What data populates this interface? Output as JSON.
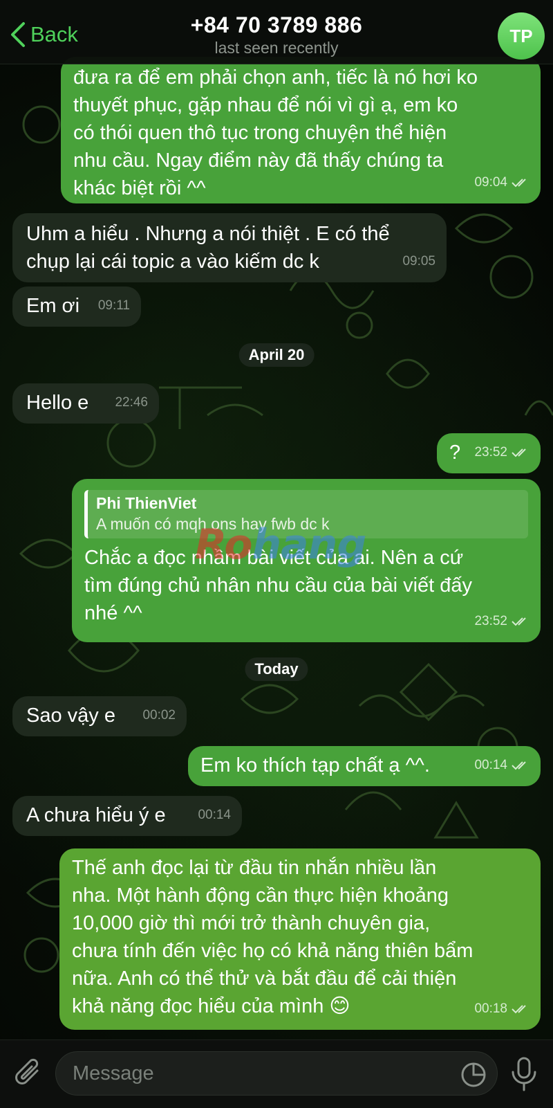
{
  "header": {
    "back_label": "Back",
    "title": "+84 70 3789 886",
    "status": "last seen recently",
    "avatar_initials": "TP"
  },
  "messages": [
    {
      "dir": "out",
      "text": "đưa ra để em phải chọn anh, tiếc là nó hơi ko\nthuyết phục, gặp nhau để nói vì gì ạ, em ko\ncó thói quen thô tục trong chuyện thể hiện\nnhu cầu. Ngay điểm này đã thấy chúng ta\nkhác biệt rồi ^^",
      "time": "09:04"
    },
    {
      "dir": "in",
      "text": "Uhm a hiểu . Nhưng a nói thiệt . E có thể\nchụp lại cái topic a vào kiếm dc k",
      "time": "09:05"
    },
    {
      "dir": "in",
      "text": "Em ơi",
      "time": "09:11"
    },
    {
      "dir": "in",
      "text": "Hello e",
      "time": "22:46"
    },
    {
      "dir": "out",
      "text": "?",
      "time": "23:52"
    },
    {
      "dir": "out",
      "reply_name": "Phi ThienViet",
      "reply_text": "A muốn có mqh ons hay fwb dc k",
      "text": "Chắc a đọc nhầm bài viết của ai. Nên a cứ\ntìm đúng chủ nhân nhu cầu của bài viết đấy\nnhé ^^",
      "time": "23:52"
    },
    {
      "dir": "in",
      "text": "Sao vậy e",
      "time": "00:02"
    },
    {
      "dir": "out",
      "text": "Em ko thích tạp chất ạ ^^.",
      "time": "00:14"
    },
    {
      "dir": "in",
      "text": "A chưa hiểu ý e",
      "time": "00:14"
    },
    {
      "dir": "out",
      "text": "Thế anh đọc lại từ đầu tin nhắn nhiều lần\nnha. Một hành động cần thực hiện khoảng\n10,000 giờ thì mới trở thành chuyên gia,\nchưa tính đến việc họ có khả năng thiên bẩm\nnữa. Anh có thể thử và bắt đầu để cải thiện\nkhả năng đọc hiểu của mình 😊",
      "time": "00:18"
    }
  ],
  "dates": [
    "April 20",
    "Today"
  ],
  "watermark": {
    "part1": "Ro",
    "part2": "hang"
  },
  "composer": {
    "placeholder": "Message"
  },
  "colors": {
    "accent": "#4fd15b",
    "outgoing": "#48a23a",
    "incoming": "#1f2a1e"
  },
  "icons": [
    "back-chevron-icon",
    "paperclip-icon",
    "sticker-icon",
    "microphone-icon",
    "double-check-icon"
  ]
}
